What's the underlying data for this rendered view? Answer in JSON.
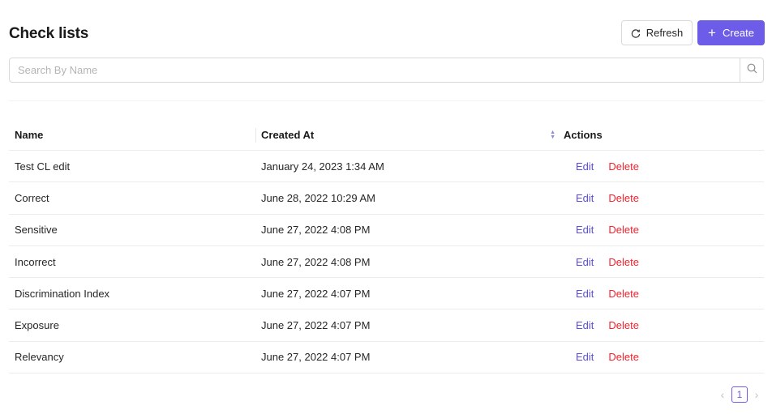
{
  "page": {
    "title": "Check lists"
  },
  "toolbar": {
    "refresh_label": "Refresh",
    "create_label": "Create"
  },
  "search": {
    "placeholder": "Search By Name",
    "value": ""
  },
  "table": {
    "columns": {
      "name": "Name",
      "created_at": "Created At",
      "actions": "Actions"
    },
    "rows": [
      {
        "name": "Test CL edit",
        "created_at": "January 24, 2023 1:34 AM",
        "edit": "Edit",
        "delete": "Delete"
      },
      {
        "name": "Correct",
        "created_at": "June 28, 2022 10:29 AM",
        "edit": "Edit",
        "delete": "Delete"
      },
      {
        "name": "Sensitive",
        "created_at": "June 27, 2022 4:08 PM",
        "edit": "Edit",
        "delete": "Delete"
      },
      {
        "name": "Incorrect",
        "created_at": "June 27, 2022 4:08 PM",
        "edit": "Edit",
        "delete": "Delete"
      },
      {
        "name": "Discrimination Index",
        "created_at": "June 27, 2022 4:07 PM",
        "edit": "Edit",
        "delete": "Delete"
      },
      {
        "name": "Exposure",
        "created_at": "June 27, 2022 4:07 PM",
        "edit": "Edit",
        "delete": "Delete"
      },
      {
        "name": "Relevancy",
        "created_at": "June 27, 2022 4:07 PM",
        "edit": "Edit",
        "delete": "Delete"
      }
    ]
  },
  "pagination": {
    "current_page": "1"
  },
  "icons": {
    "refresh": "refresh-icon",
    "create": "plus-icon",
    "search": "search-icon",
    "sort": "sort-icon",
    "prev": "chevron-left-icon",
    "next": "chevron-right-icon"
  },
  "colors": {
    "primary": "#6c5ce7",
    "edit_link": "#5b4fe0",
    "delete_link": "#f5222d"
  }
}
